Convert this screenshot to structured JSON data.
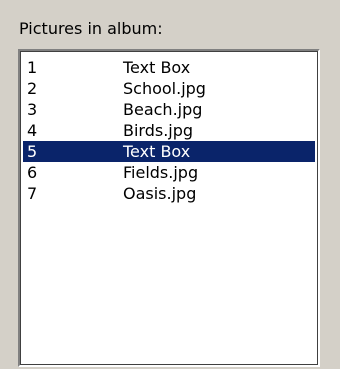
{
  "group": {
    "label": "Pictures in album:"
  },
  "list": {
    "selected_index": 4,
    "rows": [
      {
        "number": "1",
        "name": "Text Box"
      },
      {
        "number": "2",
        "name": "School.jpg"
      },
      {
        "number": "3",
        "name": "Beach.jpg"
      },
      {
        "number": "4",
        "name": "Birds.jpg"
      },
      {
        "number": "5",
        "name": "Text Box"
      },
      {
        "number": "6",
        "name": "Fields.jpg"
      },
      {
        "number": "7",
        "name": "Oasis.jpg"
      }
    ]
  },
  "colors": {
    "background": "#d4d0c8",
    "selection": "#0a246a",
    "selection_text": "#ffffff"
  }
}
